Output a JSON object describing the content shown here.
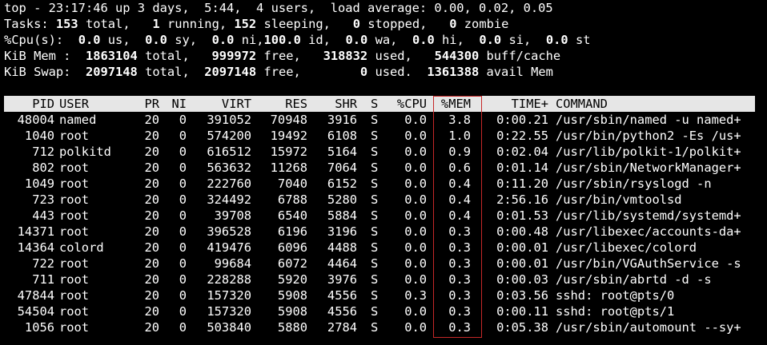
{
  "summary": {
    "line1": {
      "prefix": "top - 23:17:46 up 3 days,  5:44,  4 users,  load average: 0.00, 0.02, 0.05"
    },
    "line2": {
      "label": "Tasks:",
      "total": "153",
      "total_label": "total,",
      "running": "1",
      "running_label": "running,",
      "sleeping": "152",
      "sleeping_label": "sleeping,",
      "stopped": "0",
      "stopped_label": "stopped,",
      "zombie": "0",
      "zombie_label": "zombie"
    },
    "line3": {
      "label": "%Cpu(s):",
      "us": "0.0",
      "us_label": "us,",
      "sy": "0.0",
      "sy_label": "sy,",
      "ni": "0.0",
      "ni_label": "ni,",
      "id": "100.0",
      "id_label": "id,",
      "wa": "0.0",
      "wa_label": "wa,",
      "hi": "0.0",
      "hi_label": "hi,",
      "si": "0.0",
      "si_label": "si,",
      "st": "0.0",
      "st_label": "st"
    },
    "line4": {
      "label": "KiB Mem :",
      "total": "1863104",
      "total_label": "total,",
      "free": "999972",
      "free_label": "free,",
      "used": "318832",
      "used_label": "used,",
      "buff": "544300",
      "buff_label": "buff/cache"
    },
    "line5": {
      "label": "KiB Swap:",
      "total": "2097148",
      "total_label": "total,",
      "free": "2097148",
      "free_label": "free,",
      "used": "0",
      "used_label": "used.",
      "avail": "1361388",
      "avail_label": "avail Mem"
    }
  },
  "table": {
    "headers": {
      "pid": "PID",
      "user": "USER",
      "pr": "PR",
      "ni": "NI",
      "virt": "VIRT",
      "res": "RES",
      "shr": "SHR",
      "s": "S",
      "cpu": "%CPU",
      "mem": "%MEM",
      "time": "TIME+",
      "cmd": "COMMAND"
    },
    "rows": [
      {
        "pid": "48004",
        "user": "named",
        "pr": "20",
        "ni": "0",
        "virt": "391052",
        "res": "70948",
        "shr": "3916",
        "s": "S",
        "cpu": "0.0",
        "mem": "3.8",
        "time": "0:00.21",
        "cmd": "/usr/sbin/named -u named+"
      },
      {
        "pid": "1040",
        "user": "root",
        "pr": "20",
        "ni": "0",
        "virt": "574200",
        "res": "19492",
        "shr": "6108",
        "s": "S",
        "cpu": "0.0",
        "mem": "1.0",
        "time": "0:22.55",
        "cmd": "/usr/bin/python2 -Es /us+"
      },
      {
        "pid": "712",
        "user": "polkitd",
        "pr": "20",
        "ni": "0",
        "virt": "616512",
        "res": "15972",
        "shr": "5164",
        "s": "S",
        "cpu": "0.0",
        "mem": "0.9",
        "time": "0:02.04",
        "cmd": "/usr/lib/polkit-1/polkit+"
      },
      {
        "pid": "802",
        "user": "root",
        "pr": "20",
        "ni": "0",
        "virt": "563632",
        "res": "11268",
        "shr": "7064",
        "s": "S",
        "cpu": "0.0",
        "mem": "0.6",
        "time": "0:01.14",
        "cmd": "/usr/sbin/NetworkManager+"
      },
      {
        "pid": "1049",
        "user": "root",
        "pr": "20",
        "ni": "0",
        "virt": "222760",
        "res": "7040",
        "shr": "6152",
        "s": "S",
        "cpu": "0.0",
        "mem": "0.4",
        "time": "0:11.20",
        "cmd": "/usr/sbin/rsyslogd -n"
      },
      {
        "pid": "723",
        "user": "root",
        "pr": "20",
        "ni": "0",
        "virt": "324492",
        "res": "6788",
        "shr": "5280",
        "s": "S",
        "cpu": "0.0",
        "mem": "0.4",
        "time": "2:56.16",
        "cmd": "/usr/bin/vmtoolsd"
      },
      {
        "pid": "443",
        "user": "root",
        "pr": "20",
        "ni": "0",
        "virt": "39708",
        "res": "6540",
        "shr": "5884",
        "s": "S",
        "cpu": "0.0",
        "mem": "0.4",
        "time": "0:01.53",
        "cmd": "/usr/lib/systemd/systemd+"
      },
      {
        "pid": "14371",
        "user": "root",
        "pr": "20",
        "ni": "0",
        "virt": "396528",
        "res": "6196",
        "shr": "3196",
        "s": "S",
        "cpu": "0.0",
        "mem": "0.3",
        "time": "0:00.48",
        "cmd": "/usr/libexec/accounts-da+"
      },
      {
        "pid": "14364",
        "user": "colord",
        "pr": "20",
        "ni": "0",
        "virt": "419476",
        "res": "6096",
        "shr": "4488",
        "s": "S",
        "cpu": "0.0",
        "mem": "0.3",
        "time": "0:00.01",
        "cmd": "/usr/libexec/colord"
      },
      {
        "pid": "722",
        "user": "root",
        "pr": "20",
        "ni": "0",
        "virt": "99684",
        "res": "6072",
        "shr": "4464",
        "s": "S",
        "cpu": "0.0",
        "mem": "0.3",
        "time": "0:00.01",
        "cmd": "/usr/bin/VGAuthService -s"
      },
      {
        "pid": "711",
        "user": "root",
        "pr": "20",
        "ni": "0",
        "virt": "228288",
        "res": "5920",
        "shr": "3976",
        "s": "S",
        "cpu": "0.0",
        "mem": "0.3",
        "time": "0:00.03",
        "cmd": "/usr/sbin/abrtd -d -s"
      },
      {
        "pid": "47844",
        "user": "root",
        "pr": "20",
        "ni": "0",
        "virt": "157320",
        "res": "5908",
        "shr": "4556",
        "s": "S",
        "cpu": "0.3",
        "mem": "0.3",
        "time": "0:03.56",
        "cmd": "sshd: root@pts/0"
      },
      {
        "pid": "54504",
        "user": "root",
        "pr": "20",
        "ni": "0",
        "virt": "157320",
        "res": "5908",
        "shr": "4556",
        "s": "S",
        "cpu": "0.0",
        "mem": "0.3",
        "time": "0:00.11",
        "cmd": "sshd: root@pts/1"
      },
      {
        "pid": "1056",
        "user": "root",
        "pr": "20",
        "ni": "0",
        "virt": "503840",
        "res": "5880",
        "shr": "2784",
        "s": "S",
        "cpu": "0.0",
        "mem": "0.3",
        "time": "0:05.38",
        "cmd": "/usr/sbin/automount --sy+"
      }
    ]
  },
  "colors": {
    "background": "#000000",
    "text": "#ffffff",
    "header_bar": "#e6e6e6",
    "highlight_box": "#c62828"
  }
}
